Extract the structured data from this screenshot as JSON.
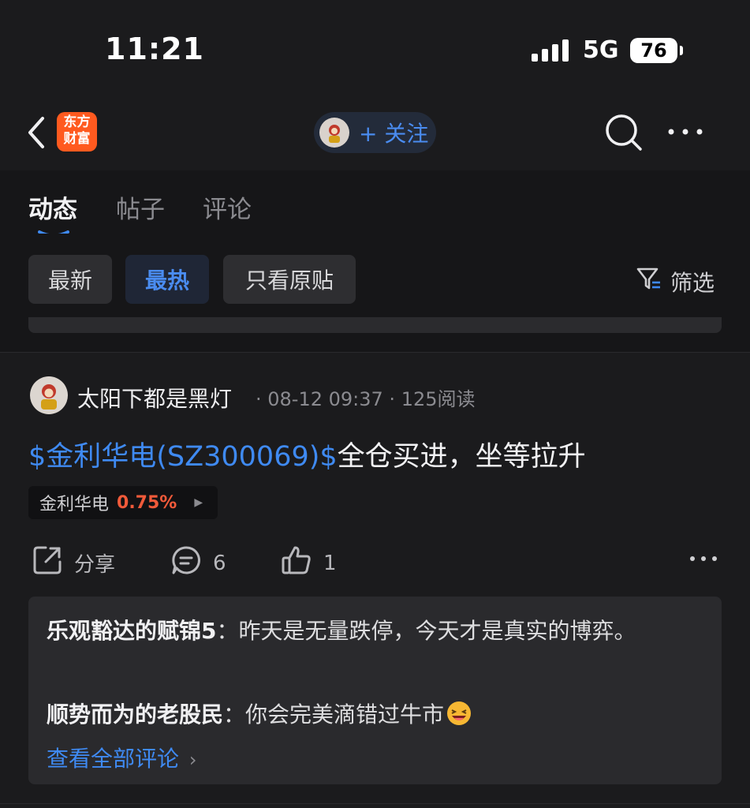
{
  "status_bar": {
    "time": "11:21",
    "network": "5G",
    "battery": "76"
  },
  "nav": {
    "logo_line1": "东方",
    "logo_line2": "财富",
    "follow_label": "+ 关注"
  },
  "tabs": [
    {
      "label": "动态",
      "active": true
    },
    {
      "label": "帖子",
      "active": false
    },
    {
      "label": "评论",
      "active": false
    }
  ],
  "filters": {
    "chips": [
      {
        "label": "最新",
        "active": false
      },
      {
        "label": "最热",
        "active": true
      },
      {
        "label": "只看原贴",
        "active": false
      }
    ],
    "filter_label": "筛选"
  },
  "post": {
    "author": "太阳下都是黑灯",
    "date": "08-12 09:37",
    "reads": "125阅读",
    "stock_link": "$金利华电(SZ300069)$",
    "text": "全仓买进，坐等拉升",
    "stock_tag": {
      "name": "金利华电",
      "change": "0.75%"
    },
    "actions": {
      "share": "分享",
      "comments": "6",
      "likes": "1"
    }
  },
  "comments": [
    {
      "user": "乐观豁达的赋锦5",
      "separator": "：",
      "text": "昨天是无量跌停，今天才是真实的博弈。"
    },
    {
      "user": "顺势而为的老股民",
      "separator": "：",
      "text": "你会完美滴错过牛市"
    }
  ],
  "view_all_label": "查看全部评论",
  "colors": {
    "accent_blue": "#3f8af2",
    "up_red": "#f05a3a",
    "logo_orange": "#ff5a1f"
  }
}
